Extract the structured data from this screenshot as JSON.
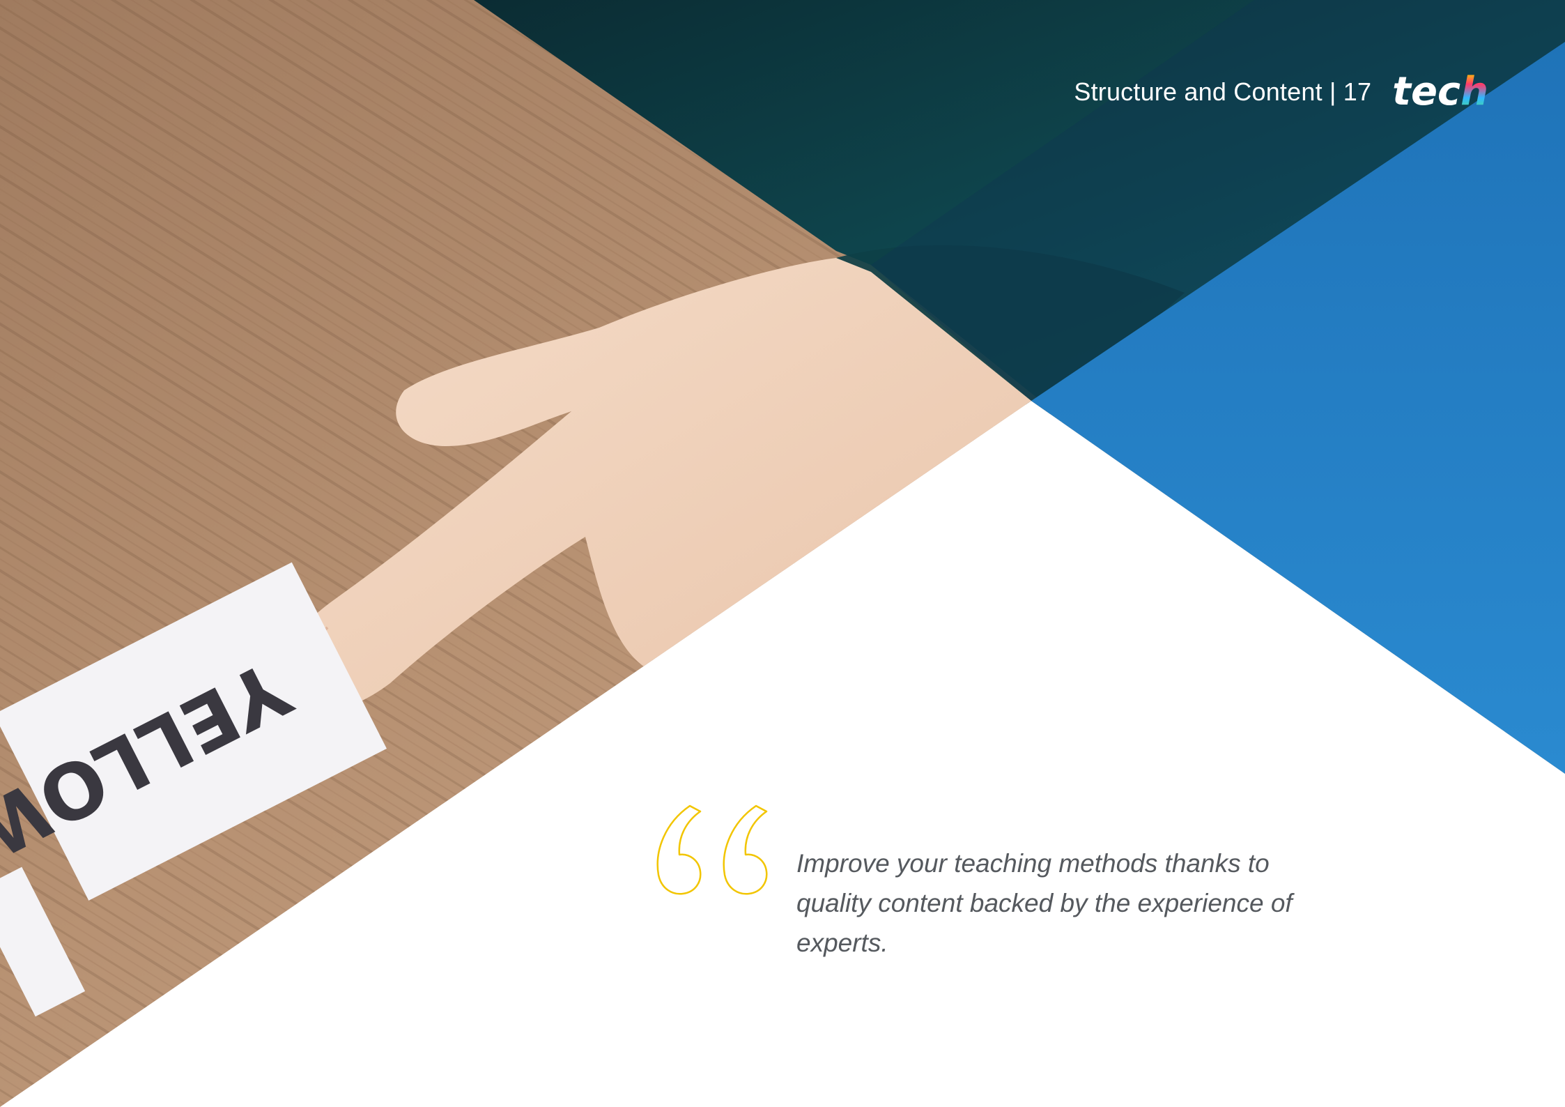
{
  "header": {
    "section_title": "Structure and Content | 17",
    "logo_text_main": "tec",
    "logo_text_accent": "h"
  },
  "quote": {
    "text": "Improve your teaching methods thanks to quality content backed by the experience of experts.",
    "mark_icon": "open-quote-icon",
    "mark_color": "#f2c500"
  },
  "photo": {
    "card_word": "YELLOW"
  },
  "colors": {
    "accent_blue": "#2a82c6",
    "dark_teal": "#0f3f45",
    "wood": "#b2896a",
    "quote_text": "#55595e"
  }
}
